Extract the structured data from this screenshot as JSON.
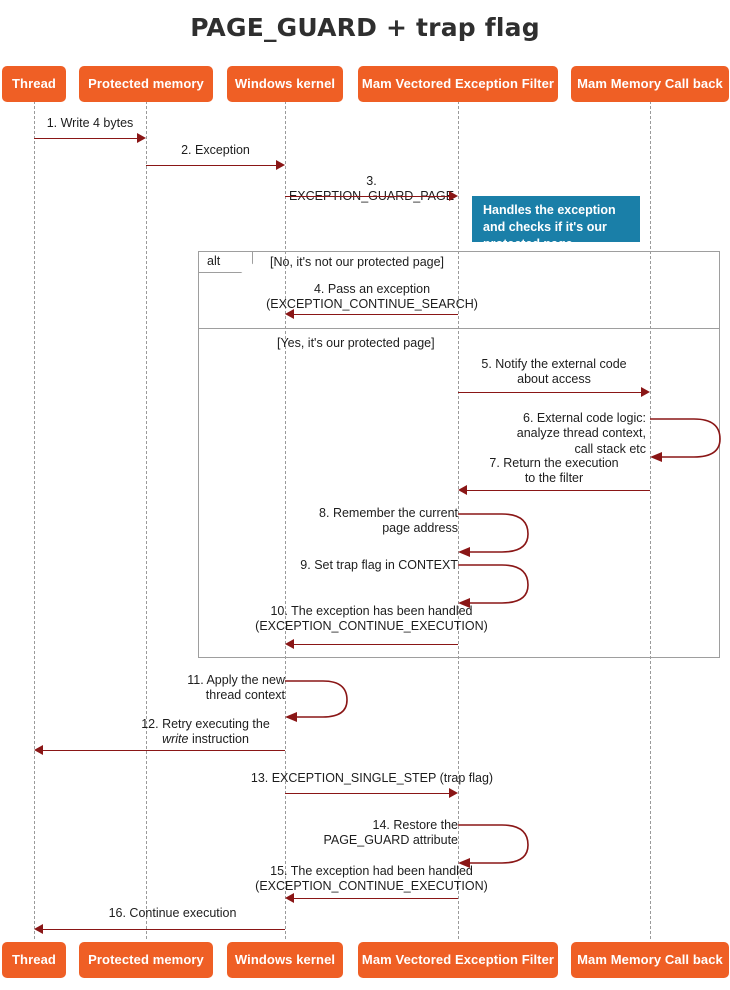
{
  "title": "PAGE_GUARD + trap flag",
  "colors": {
    "actor_fill": "#ef5f25",
    "actor_text": "#ffffff",
    "arrow": "#8a1616",
    "note_fill": "#1a7fa8",
    "note_text": "#ffffff",
    "lifeline": "#9a9a9a",
    "frame_border": "#9e9e9e",
    "title_text": "#2f2f2f"
  },
  "participants": [
    {
      "id": "thread",
      "label": "Thread"
    },
    {
      "id": "protected-memory",
      "label": "Protected memory"
    },
    {
      "id": "windows-kernel",
      "label": "Windows kernel"
    },
    {
      "id": "vectored-exception-filter",
      "label": "Mam Vectored Exception Filter"
    },
    {
      "id": "memory-call-back",
      "label": "Mam Memory Call back"
    }
  ],
  "messages": [
    {
      "num": "1.",
      "text": "1. Write 4 bytes",
      "from": "thread",
      "to": "protected-memory",
      "kind": "call"
    },
    {
      "num": "2.",
      "text": "2. Exception",
      "from": "protected-memory",
      "to": "windows-kernel",
      "kind": "call"
    },
    {
      "num": "3.",
      "text": "3. EXCEPTION_GUARD_PAGE",
      "from": "windows-kernel",
      "to": "vectored-exception-filter",
      "kind": "call"
    },
    {
      "num": "4.",
      "text": "4. Pass an exception\n(EXCEPTION_CONTINUE_SEARCH)",
      "from": "vectored-exception-filter",
      "to": "windows-kernel",
      "kind": "return"
    },
    {
      "num": "5.",
      "text": "5. Notify the external code\nabout access",
      "from": "vectored-exception-filter",
      "to": "memory-call-back",
      "kind": "call"
    },
    {
      "num": "6.",
      "text": "6. External code logic:\nanalyze thread context,\ncall stack etc",
      "from": "memory-call-back",
      "to": "memory-call-back",
      "kind": "self"
    },
    {
      "num": "7.",
      "text": "7. Return the execution\nto the filter",
      "from": "memory-call-back",
      "to": "vectored-exception-filter",
      "kind": "return"
    },
    {
      "num": "8.",
      "text": "8. Remember the current\npage address",
      "from": "vectored-exception-filter",
      "to": "vectored-exception-filter",
      "kind": "self"
    },
    {
      "num": "9.",
      "text": "9. Set trap flag in CONTEXT",
      "from": "vectored-exception-filter",
      "to": "vectored-exception-filter",
      "kind": "self"
    },
    {
      "num": "10.",
      "text": "10. The exception has been handled\n(EXCEPTION_CONTINUE_EXECUTION)",
      "from": "vectored-exception-filter",
      "to": "windows-kernel",
      "kind": "return"
    },
    {
      "num": "11.",
      "text": "11. Apply the new\nthread context",
      "from": "windows-kernel",
      "to": "windows-kernel",
      "kind": "self"
    },
    {
      "num": "12.",
      "text": "12. Retry executing the\nwrite instruction",
      "from": "windows-kernel",
      "to": "thread",
      "kind": "return",
      "italic_word": "write"
    },
    {
      "num": "13.",
      "text": "13. EXCEPTION_SINGLE_STEP (trap flag)",
      "from": "windows-kernel",
      "to": "vectored-exception-filter",
      "kind": "call"
    },
    {
      "num": "14.",
      "text": "14. Restore the\nPAGE_GUARD attribute",
      "from": "vectored-exception-filter",
      "to": "vectored-exception-filter",
      "kind": "self"
    },
    {
      "num": "15.",
      "text": "15. The exception had been handled\n(EXCEPTION_CONTINUE_EXECUTION)",
      "from": "vectored-exception-filter",
      "to": "windows-kernel",
      "kind": "return"
    },
    {
      "num": "16.",
      "text": "16. Continue execution",
      "from": "windows-kernel",
      "to": "thread",
      "kind": "return"
    }
  ],
  "note": {
    "text": "Handles the exception\nand checks if it's our\nprotected page"
  },
  "fragment": {
    "operator": "alt",
    "guards": [
      "[No, it's not our protected page]",
      "[Yes, it's our protected page]"
    ]
  }
}
